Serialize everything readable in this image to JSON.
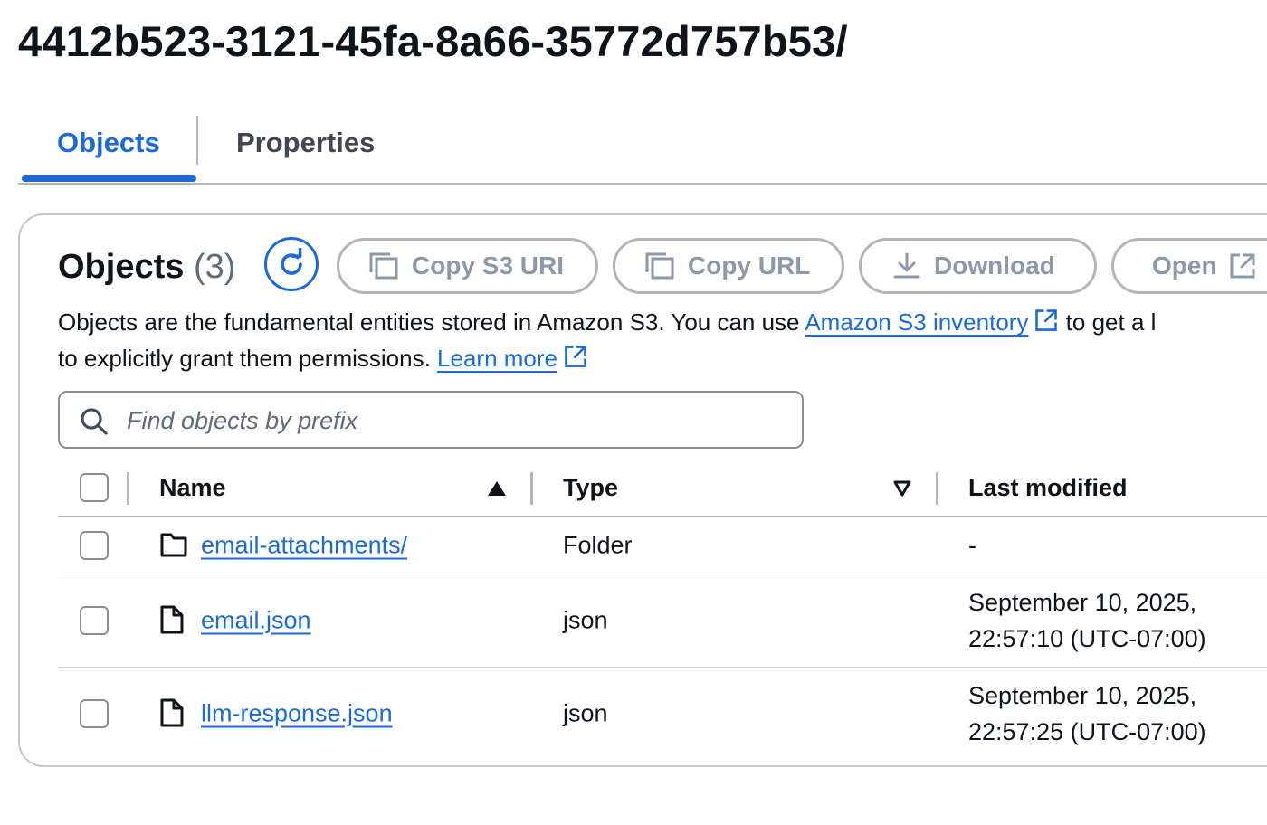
{
  "page": {
    "title": "4412b523-3121-45fa-8a66-35772d757b53/"
  },
  "tabs": [
    {
      "label": "Objects",
      "active": true
    },
    {
      "label": "Properties",
      "active": false
    }
  ],
  "objects_panel": {
    "heading": "Objects",
    "count": "(3)",
    "actions": {
      "copy_s3_uri": "Copy S3 URI",
      "copy_url": "Copy URL",
      "download": "Download",
      "open": "Open"
    },
    "description": {
      "line1_text": "Objects are the fundamental entities stored in Amazon S3. You can use ",
      "inventory_link": "Amazon S3 inventory",
      "line1_tail": " to get a l",
      "line2_text": "to explicitly grant them permissions. ",
      "learn_more": "Learn more"
    },
    "search": {
      "placeholder": "Find objects by prefix",
      "value": ""
    }
  },
  "table": {
    "columns": {
      "name": "Name",
      "type": "Type",
      "last_modified": "Last modified"
    },
    "rows": [
      {
        "icon": "folder-icon",
        "name": "email-attachments/",
        "type": "Folder",
        "last_modified_line1": "-",
        "last_modified_line2": ""
      },
      {
        "icon": "file-icon",
        "name": "email.json",
        "type": "json",
        "last_modified_line1": "September 10, 2025,",
        "last_modified_line2": "22:57:10 (UTC-07:00)"
      },
      {
        "icon": "file-icon",
        "name": "llm-response.json",
        "type": "json",
        "last_modified_line1": "September 10, 2025,",
        "last_modified_line2": "22:57:25 (UTC-07:00)"
      }
    ]
  },
  "colors": {
    "link": "#1d6ad6",
    "text": "#0f141a",
    "muted": "#5f6b7a",
    "disabled": "#8d99a8",
    "border": "#b4b4bb"
  }
}
